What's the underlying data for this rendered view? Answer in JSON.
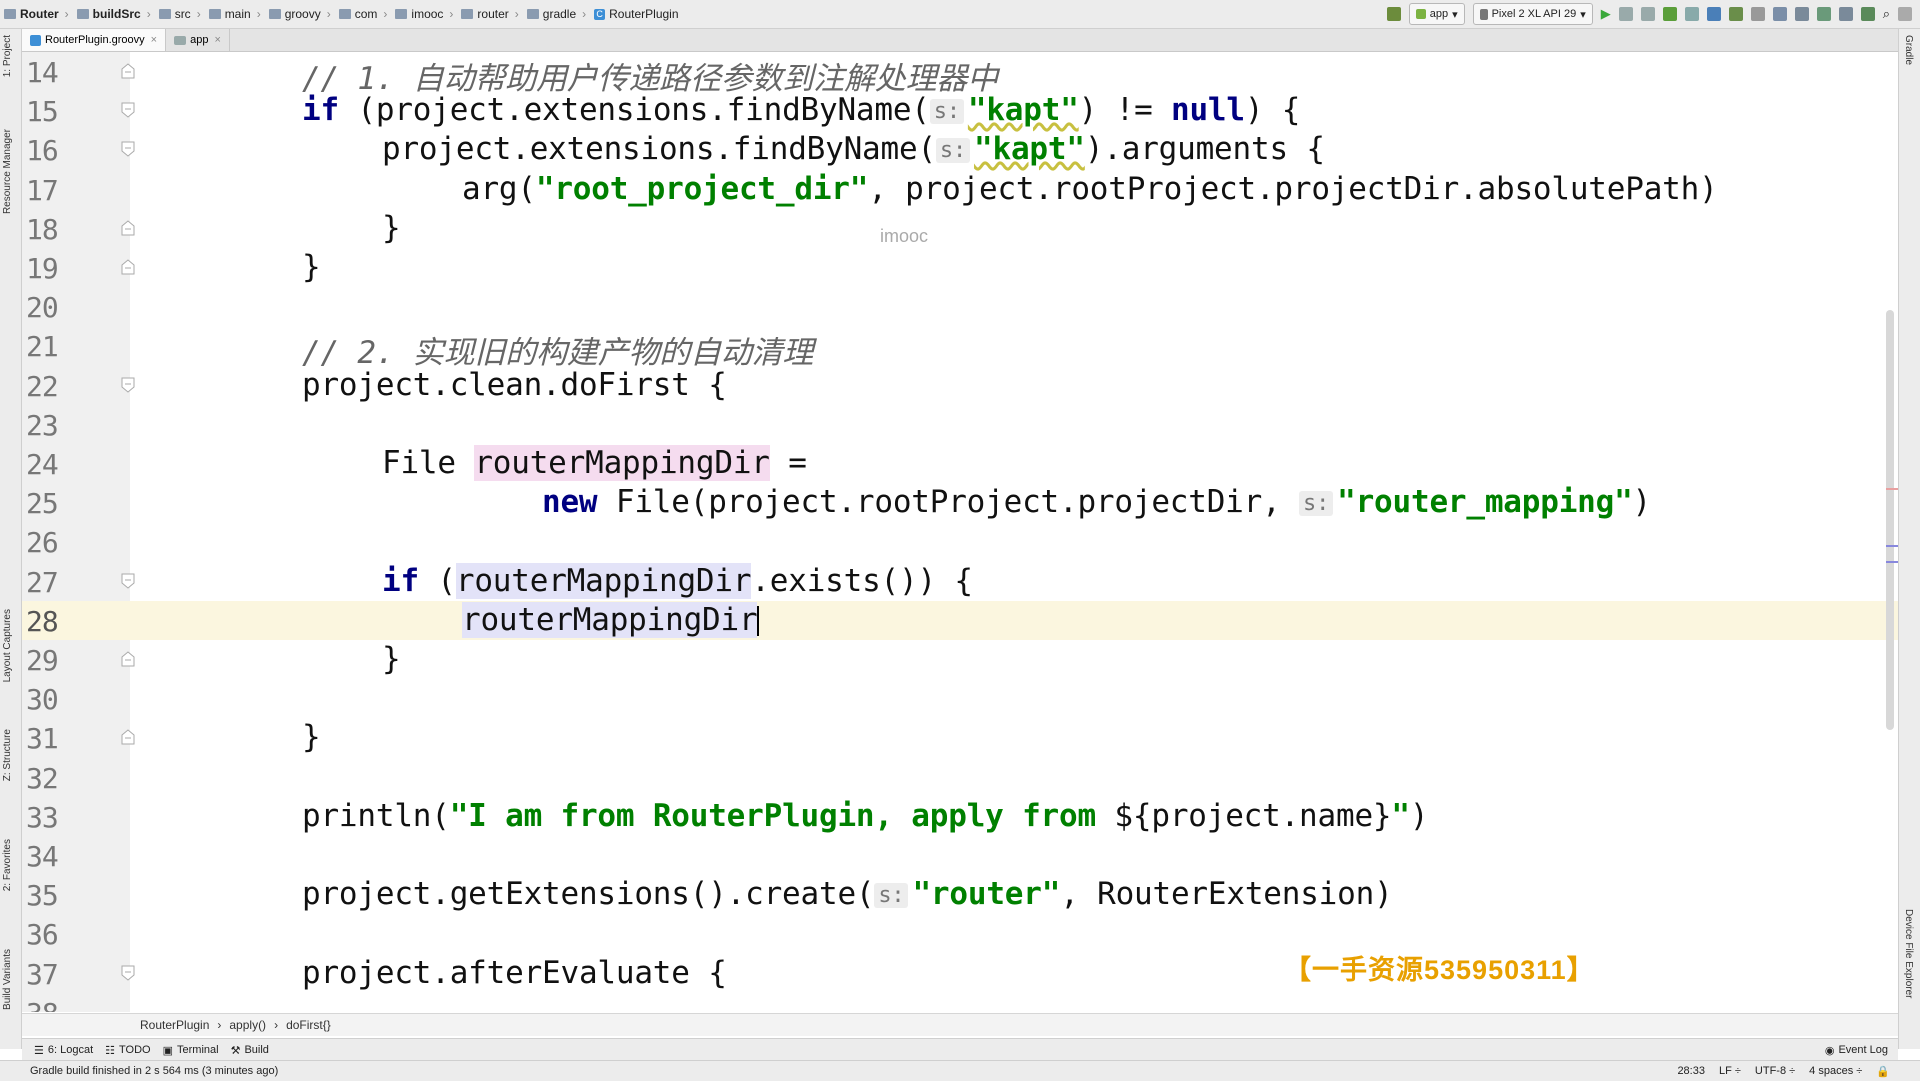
{
  "breadcrumb": [
    "Router",
    "buildSrc",
    "src",
    "main",
    "groovy",
    "com",
    "imooc",
    "router",
    "gradle",
    "RouterPlugin"
  ],
  "toolbar": {
    "run_config": "app",
    "device": "Pixel 2 XL API 29"
  },
  "tabs": [
    {
      "label": "RouterPlugin.groovy",
      "active": true
    },
    {
      "label": "app",
      "active": false
    }
  ],
  "left_panels": [
    "1: Project",
    "Resource Manager",
    "Layout Captures",
    "Z: Structure",
    "2: Favorites",
    "Build Variants"
  ],
  "right_panels": [
    "Gradle",
    "Device File Explorer"
  ],
  "lines": [
    {
      "n": "14",
      "tokens": [
        [
          "cm",
          "// 1. 自动帮助用户传递路径参数到注解处理器中"
        ]
      ],
      "indent": 0,
      "fold": "end"
    },
    {
      "n": "15",
      "tokens": [
        [
          "kw",
          "if"
        ],
        [
          "t",
          " (project.extensions.findByName("
        ],
        [
          "hint",
          "s:"
        ],
        [
          "str",
          "\"kapt\""
        ],
        [
          "t",
          ") != "
        ],
        [
          "kw",
          "null"
        ],
        [
          "t",
          ") {"
        ]
      ],
      "indent": 0,
      "fold": "start"
    },
    {
      "n": "16",
      "tokens": [
        [
          "t",
          "project.extensions.findByName("
        ],
        [
          "hint",
          "s:"
        ],
        [
          "str",
          "\"kapt\""
        ],
        [
          "t",
          ").arguments {"
        ]
      ],
      "indent": 1,
      "fold": "start"
    },
    {
      "n": "17",
      "tokens": [
        [
          "t",
          "arg("
        ],
        [
          "str",
          "\"root_project_dir\""
        ],
        [
          "t",
          ", project.rootProject.projectDir.absolutePath)"
        ]
      ],
      "indent": 2,
      "fold": ""
    },
    {
      "n": "18",
      "tokens": [
        [
          "t",
          "}"
        ]
      ],
      "indent": 1,
      "fold": "end"
    },
    {
      "n": "19",
      "tokens": [
        [
          "t",
          "}"
        ]
      ],
      "indent": 0,
      "fold": "end"
    },
    {
      "n": "20",
      "tokens": [],
      "indent": 0,
      "fold": ""
    },
    {
      "n": "21",
      "tokens": [
        [
          "cm",
          "// 2. 实现旧的构建产物的自动清理"
        ]
      ],
      "indent": 0,
      "fold": ""
    },
    {
      "n": "22",
      "tokens": [
        [
          "t",
          "project.clean.doFirst {"
        ]
      ],
      "indent": 0,
      "fold": "start"
    },
    {
      "n": "23",
      "tokens": [],
      "indent": 0,
      "fold": ""
    },
    {
      "n": "24",
      "tokens": [
        [
          "t",
          "File "
        ],
        [
          "hlw",
          "routerMappingDir"
        ],
        [
          "t",
          " ="
        ]
      ],
      "indent": 1,
      "fold": ""
    },
    {
      "n": "25",
      "tokens": [
        [
          "kw",
          "new"
        ],
        [
          "t",
          " File(project.rootProject.projectDir, "
        ],
        [
          "hint",
          "s:"
        ],
        [
          "str",
          "\"router_mapping\""
        ],
        [
          "t",
          ")"
        ]
      ],
      "indent": 3,
      "fold": ""
    },
    {
      "n": "26",
      "tokens": [],
      "indent": 0,
      "fold": ""
    },
    {
      "n": "27",
      "tokens": [
        [
          "kw",
          "if"
        ],
        [
          "t",
          " ("
        ],
        [
          "hlr",
          "routerMappingDir"
        ],
        [
          "t",
          ".exists()) {"
        ]
      ],
      "indent": 1,
      "fold": "start"
    },
    {
      "n": "28",
      "tokens": [
        [
          "hlr",
          "routerMappingDir"
        ],
        [
          "caret",
          ""
        ]
      ],
      "indent": 2,
      "fold": "",
      "current": true
    },
    {
      "n": "29",
      "tokens": [
        [
          "t",
          "}"
        ]
      ],
      "indent": 1,
      "fold": "end"
    },
    {
      "n": "30",
      "tokens": [],
      "indent": 0,
      "fold": ""
    },
    {
      "n": "31",
      "tokens": [
        [
          "t",
          "}"
        ]
      ],
      "indent": 0,
      "fold": "end"
    },
    {
      "n": "32",
      "tokens": [],
      "indent": 0,
      "fold": ""
    },
    {
      "n": "33",
      "tokens": [
        [
          "t",
          "println("
        ],
        [
          "str",
          "\"I am from RouterPlugin, apply from "
        ],
        [
          "t",
          "${project.name}"
        ],
        [
          "str",
          "\""
        ],
        [
          "t",
          ")"
        ]
      ],
      "indent": 0,
      "fold": ""
    },
    {
      "n": "34",
      "tokens": [],
      "indent": 0,
      "fold": ""
    },
    {
      "n": "35",
      "tokens": [
        [
          "t",
          "project.getExtensions().create("
        ],
        [
          "hint",
          "s:"
        ],
        [
          "str",
          "\"router\""
        ],
        [
          "t",
          ", RouterExtension)"
        ]
      ],
      "indent": 0,
      "fold": ""
    },
    {
      "n": "36",
      "tokens": [],
      "indent": 0,
      "fold": ""
    },
    {
      "n": "37",
      "tokens": [
        [
          "t",
          "project.afterEvaluate {"
        ]
      ],
      "indent": 0,
      "fold": "start"
    },
    {
      "n": "38",
      "tokens": [],
      "indent": 0,
      "fold": ""
    }
  ],
  "watermark": "imooc",
  "promo": "【一手资源535950311】",
  "code_breadcrumb": [
    "RouterPlugin",
    "apply()",
    "doFirst{}"
  ],
  "tool_windows": [
    "6: Logcat",
    "TODO",
    "Terminal",
    "Build"
  ],
  "status": {
    "message": "Gradle build finished in 2 s 564 ms (3 minutes ago)",
    "position": "28:33",
    "line_sep": "LF ÷",
    "encoding": "UTF-8 ÷",
    "indent": "4 spaces ÷",
    "event_log": "Event Log"
  }
}
